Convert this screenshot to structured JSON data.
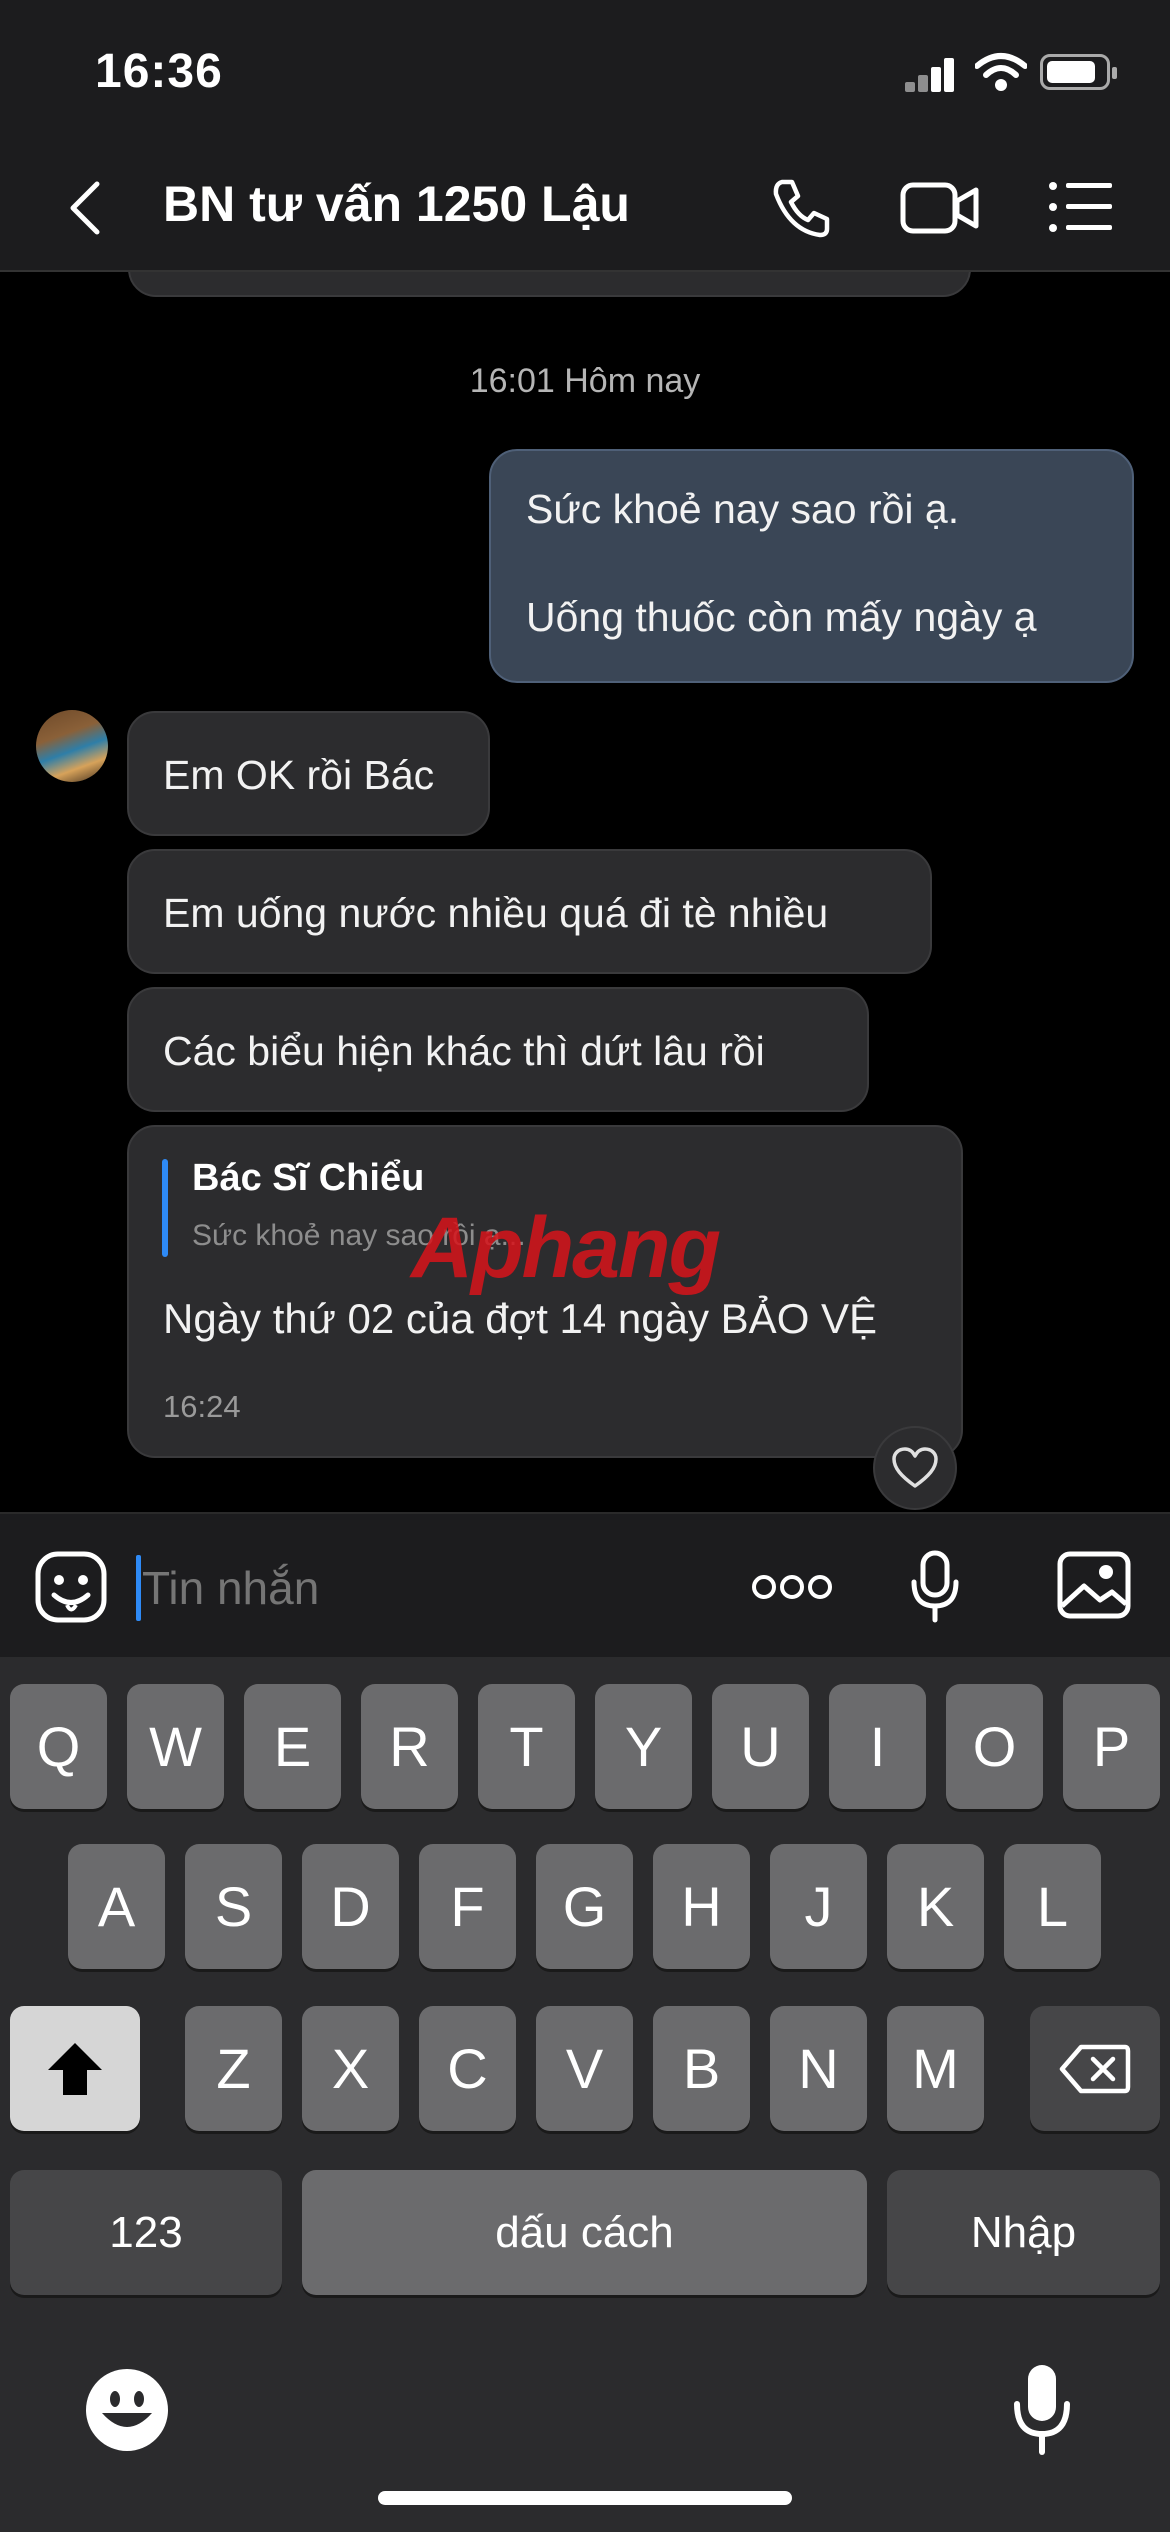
{
  "status_bar": {
    "time": "16:36"
  },
  "header": {
    "title": "BN tư vấn 1250 Lậu"
  },
  "chat": {
    "date_divider": "16:01 Hôm nay",
    "outgoing": {
      "line1": "Sức khoẻ nay sao rồi ạ.",
      "line2": "Uống thuốc còn mấy ngày ạ"
    },
    "incoming": [
      "Em OK rồi Bác",
      "Em uống nước nhiều quá đi tè nhiều",
      "Các biểu hiện khác thì dứt lâu rồi"
    ],
    "reply_message": {
      "quote_author": "Bác Sĩ Chiểu",
      "quote_text": "Sức khoẻ nay sao rồi ạ...",
      "text": "Ngày thứ 02 của đợt 14 ngày BẢO VỆ",
      "time": "16:24"
    },
    "watermark": "Aphang"
  },
  "input": {
    "placeholder": "Tin nhắn"
  },
  "keyboard": {
    "row1": [
      "Q",
      "W",
      "E",
      "R",
      "T",
      "Y",
      "U",
      "I",
      "O",
      "P"
    ],
    "row2": [
      "A",
      "S",
      "D",
      "F",
      "G",
      "H",
      "J",
      "K",
      "L"
    ],
    "row3": [
      "Z",
      "X",
      "C",
      "V",
      "B",
      "N",
      "M"
    ],
    "numbers_label": "123",
    "space_label": "dấu cách",
    "return_label": "Nhập"
  },
  "icons": [
    "back-icon",
    "phone-icon",
    "video-icon",
    "menu-icon",
    "sticker-icon",
    "more-icon",
    "mic-icon",
    "image-icon",
    "heart-icon",
    "shift-icon",
    "backspace-icon",
    "emoji-icon",
    "dictation-icon"
  ]
}
